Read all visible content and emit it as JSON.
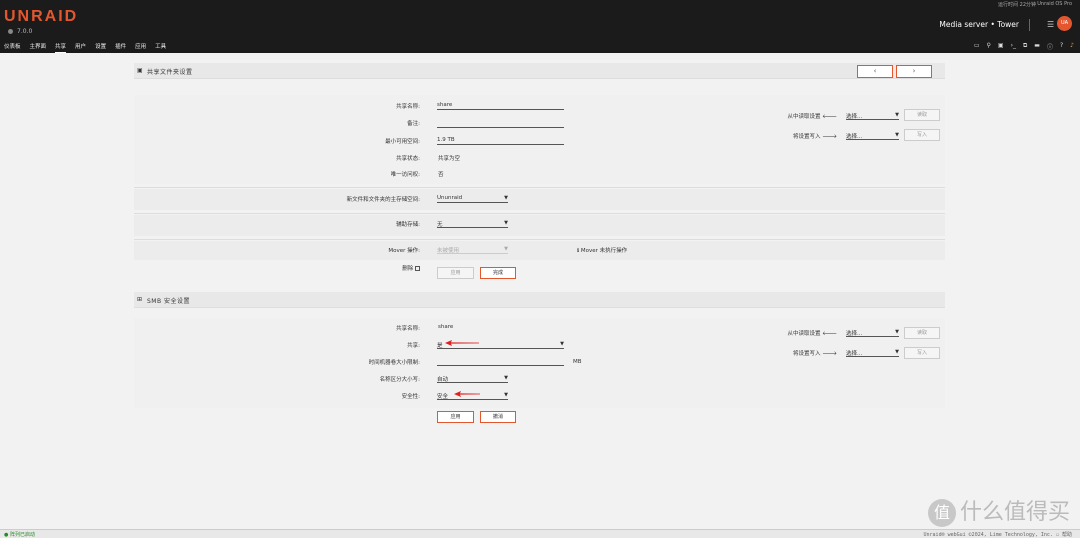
{
  "header": {
    "logo": "UNRAID",
    "version": "7.0.0",
    "uptime": "运行时间 22分钟",
    "edition": "Unraid OS Pro",
    "server": "Media server • Tower",
    "avatar": "UA",
    "nav": [
      "仪表板",
      "主界面",
      "共享",
      "用户",
      "设置",
      "插件",
      "应用",
      "工具"
    ],
    "active_nav": "共享"
  },
  "share_settings": {
    "title": "共享文件夹设置",
    "prev": "‹",
    "next": "›",
    "name_label": "共享名称:",
    "name_value": "share",
    "comment_label": "备注:",
    "comment_value": "",
    "minfree_label": "最小可用空间:",
    "minfree_value": "1.9 TB",
    "status_label": "共享状态:",
    "status_value": "共享为空",
    "exclusive_label": "唯一访问权:",
    "exclusive_value": "否",
    "primary_label": "新文件和文件夹的主存储空间:",
    "primary_value": "Ununraid",
    "secondary_label": "辅助存储:",
    "secondary_value": "无",
    "mover_label": "Mover 操作:",
    "mover_value": "未被使用",
    "mover_info": "Mover 未执行操作",
    "delete_label": "删除",
    "apply": "应用",
    "done": "完成",
    "read_from_label": "从中读取设置",
    "read_from_value": "选择...",
    "read_btn": "读取",
    "write_to_label": "将设置写入",
    "write_to_value": "选择...",
    "write_btn": "写入"
  },
  "smb_settings": {
    "title": "SMB 安全设置",
    "name_label": "共享名称:",
    "name_value": "share",
    "export_label": "共享:",
    "export_value": "是",
    "tm_label": "时间机器卷大小限制:",
    "tm_unit": "MB",
    "case_label": "名称区分大小写:",
    "case_value": "自动",
    "security_label": "安全性:",
    "security_value": "安全",
    "apply": "应用",
    "done": "撤消",
    "read_from_label": "从中读取设置",
    "read_from_value": "选择...",
    "read_btn": "读取",
    "write_to_label": "将设置写入",
    "write_to_value": "选择...",
    "write_btn": "写入"
  },
  "footer": {
    "status": "● 阵列已启动",
    "copyright": "Unraid® webGui ©2024, Lime Technology, Inc.  ☐ 帮助"
  },
  "watermark": "什么值得买",
  "colors": {
    "accent": "#e4572e",
    "header_bg": "#1c1b1b"
  }
}
